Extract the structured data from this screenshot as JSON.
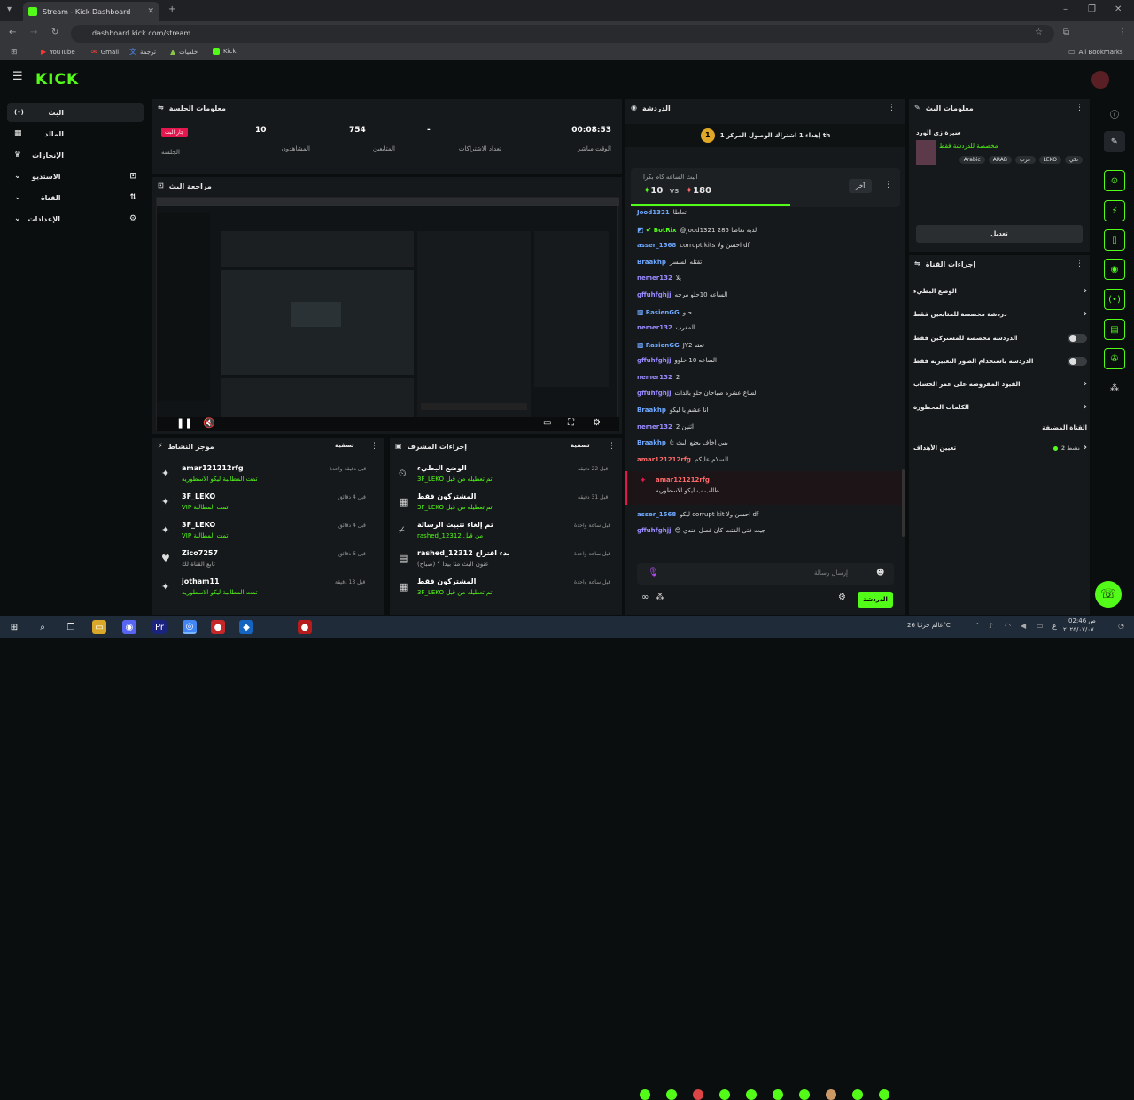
{
  "browser": {
    "tab_title": "Stream - Kick Dashboard",
    "url": "dashboard.kick.com/stream",
    "profile": "A",
    "bookmarks": [
      "YouTube",
      "Gmail",
      "ترجمة",
      "خلفيات",
      "Kick"
    ],
    "all_bookmarks": "All Bookmarks"
  },
  "brand": {
    "logo": "KICK",
    "accent": "#53fc18"
  },
  "nav": [
    {
      "label": "البث",
      "icon": "(•)"
    },
    {
      "label": "المالد",
      "icon": "▦"
    },
    {
      "label": "الإنجازات",
      "icon": "🏆"
    },
    {
      "label": "الاستديو",
      "icon": "⊡"
    },
    {
      "label": "القناة",
      "icon": "⇅"
    },
    {
      "label": "الإعدادات",
      "icon": "⚙"
    }
  ],
  "session": {
    "title": "معلومات الجلسة",
    "live_badge": "جار البث",
    "session_label": "الجلسة",
    "stats": [
      {
        "value": "00:08:53",
        "label": "الوقت مباشر"
      },
      {
        "value": "-",
        "label": "تعداد الاشتراكات"
      },
      {
        "value": "754",
        "label": "المتابعين"
      },
      {
        "value": "10",
        "label": "المشاهدون"
      }
    ]
  },
  "preview": {
    "title": "مراجعة البث"
  },
  "activity": {
    "title": "موجز النشاط",
    "filter": "تصفية",
    "items": [
      {
        "name": "amar121212rfg",
        "sub": "تمت المطالبة ليكو الاسطوريه",
        "time": "قبل دقيقة واحدة"
      },
      {
        "name": "3F_LEKO",
        "sub": "VIP تمت المطالبة",
        "time": "قبل 4 دقائق"
      },
      {
        "name": "3F_LEKO",
        "sub": "VIP تمت المطالبة",
        "time": "قبل 4 دقائق"
      },
      {
        "name": "Zico7257",
        "sub": "تابع القناة لك",
        "time": "قبل 6 دقائق"
      },
      {
        "name": "jotham11",
        "sub": "تمت المطالبة ليكو الاسطوريه",
        "time": "قبل 13 دقيقة"
      }
    ]
  },
  "modactions": {
    "title": "إجراءات المشرف",
    "filter": "تصفية",
    "items": [
      {
        "name": "الوضع البطيء",
        "sub": "3F_LEKO تم تعطيله من قبل",
        "time": "قبل 22 دقيقة"
      },
      {
        "name": "المشتركون فقط",
        "sub": "3F_LEKO تم تعطيله من قبل",
        "time": "قبل 31 دقيقة"
      },
      {
        "name": "تم إلغاء تثبيت الرسالة",
        "sub": "rashed_12312 من قبل",
        "time": "قبل ساعة واحدة"
      },
      {
        "name": "rashed_12312 بدء اقتراع",
        "sub": "عنون البث متا بيدا ؟ (صباح)",
        "time": "قبل ساعة واحدة"
      },
      {
        "name": "المشتركون فقط",
        "sub": "3F_LEKO تم تعطيله من قبل",
        "time": "قبل ساعة واحدة"
      }
    ]
  },
  "chat": {
    "title": "الدردشة",
    "goal_text": "إهداء 1 اشتراك الوصول المركز 1 th",
    "goal_badge": "1",
    "poll_question": "البث الساعه كام بكرا",
    "poll_a": "10",
    "poll_vs": "VS",
    "poll_b": "180",
    "poll_btn": "آخر",
    "messages": [
      {
        "user": "Jood1321",
        "text": "تعاطا",
        "color": "#6ea8fe"
      },
      {
        "user": "BotRix",
        "text": "@Jood1321 285 لديه تعاطا",
        "color": "#53fc18"
      },
      {
        "user": "asser_1568",
        "text": "corrupt kits احسن ولا df",
        "color": "#6ea8fe"
      },
      {
        "user": "Braakhp",
        "text": "تقتله السسر",
        "color": "#6ea8fe"
      },
      {
        "user": "nemer132",
        "text": "يلا",
        "color": "#9b8cff"
      },
      {
        "user": "gffuhfghjj",
        "text": "الساعه 10حلو مرحه",
        "color": "#9b8cff"
      },
      {
        "user": "RasienGG",
        "text": "حلو",
        "color": "#6ea8fe"
      },
      {
        "user": "nemer132",
        "text": "المغرب",
        "color": "#9b8cff"
      },
      {
        "user": "RasienGG",
        "text": "JY2 تعتد",
        "color": "#6ea8fe"
      },
      {
        "user": "gffuhfghjj",
        "text": "الساعه 10 خلوو",
        "color": "#9b8cff"
      },
      {
        "user": "nemer132",
        "text": "2",
        "color": "#9b8cff"
      },
      {
        "user": "gffuhfghjj",
        "text": "الساع عشره صباحان حلو بالذات",
        "color": "#9b8cff"
      },
      {
        "user": "Braakhp",
        "text": "انا عشم يا ليكو",
        "color": "#6ea8fe"
      },
      {
        "user": "nemer132",
        "text": "اثنين 2",
        "color": "#9b8cff"
      },
      {
        "user": "Braakhp",
        "text": "(: بس اخاف يحنع البث",
        "color": "#6ea8fe"
      },
      {
        "user": "amar121212rfg",
        "text": "السلام عليكم",
        "color": "#ff6b6b"
      }
    ],
    "highlight_user": "amar121212rfg",
    "highlight_text": "طالب ب ليكو الاسطوريه",
    "messages_after": [
      {
        "user": "asser_1568",
        "text": "ليكو corrupt kit احسن ولا df",
        "color": "#6ea8fe"
      },
      {
        "user": "gffuhfghjj",
        "text": "😊 جيت فتى الفتت كان فصل عندي",
        "color": "#9b8cff"
      }
    ],
    "input_placeholder": "إرسال رسالة",
    "send_label": "الدردشة"
  },
  "streaminfo": {
    "title": "معلومات البث",
    "stream_title": "سيرة زي الورد",
    "category": "مخصصة للدردشة فقط",
    "tags": [
      "نكي",
      "LEKO",
      "عرب",
      "ARAB",
      "Arabic"
    ],
    "edit_label": "تعديل"
  },
  "channelactions": {
    "title": "إجراءات القناة",
    "items": [
      {
        "label": "الوضع البطيء",
        "control": "chevron"
      },
      {
        "label": "دردشة مخصصة للمتابعين فقط",
        "control": "chevron"
      },
      {
        "label": "الدردشة مخصصة للمشتركين فقط",
        "control": "toggle"
      },
      {
        "label": "الدردشة باستخدام الصور التعبيرية فقط",
        "control": "toggle"
      },
      {
        "label": "القيود المفروضة على عمر الحساب",
        "control": "chevron"
      },
      {
        "label": "الكلمات المحظورة",
        "control": "chevron"
      }
    ],
    "featured": "القناة المضيفة",
    "goals": "تعيين الأهداف",
    "goals_count": "نشط 2"
  },
  "taskbar": {
    "weather": "غالم جزئيا 26°C",
    "time": "02:46 ص",
    "date": "٢٠٢٥/٠٧/٠٧",
    "lang": "ع"
  }
}
